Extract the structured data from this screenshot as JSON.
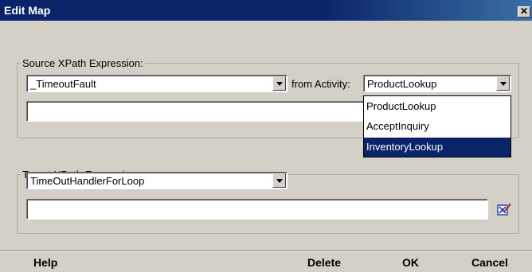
{
  "window": {
    "title": "Edit Map",
    "close_icon": "close-icon"
  },
  "source": {
    "legend": "Source XPath Expression:",
    "combo_value": "_TimeoutFault",
    "from_label": "from Activity:",
    "activity_value": "ProductLookup",
    "expression_value": "",
    "edit_icon": "edit-expression-icon",
    "activity_options": [
      {
        "label": "ProductLookup",
        "selected": false
      },
      {
        "label": "AcceptInquiry",
        "selected": false
      },
      {
        "label": "InventoryLookup",
        "selected": true
      }
    ]
  },
  "target": {
    "legend": "Target XPath Expression:",
    "combo_value": "TimeOutHandlerForLoop",
    "expression_value": "",
    "edit_icon": "edit-expression-icon"
  },
  "footer": {
    "help_label": "Help",
    "delete_label": "Delete",
    "ok_label": "OK",
    "cancel_label": "Cancel"
  },
  "colors": {
    "titlebar": "#0a246a",
    "selection": "#0a246a",
    "dialog_bg": "#d4d0c8"
  }
}
